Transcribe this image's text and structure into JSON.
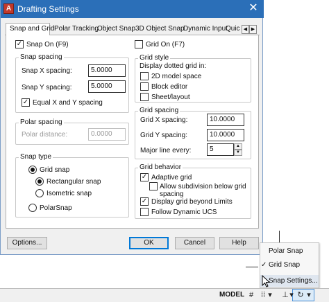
{
  "dialog": {
    "title": "Drafting Settings",
    "close_glyph": "✕",
    "tabs": [
      {
        "label": "Snap and Grid",
        "active": true
      },
      {
        "label": "Polar Tracking"
      },
      {
        "label": "Object Snap"
      },
      {
        "label": "3D Object Snap"
      },
      {
        "label": "Dynamic Input"
      },
      {
        "label": "Quic"
      }
    ],
    "tab_scroll_left": "◀",
    "tab_scroll_right": "▶",
    "snap_on": {
      "label": "Snap On (F9)",
      "checked": true
    },
    "grid_on": {
      "label": "Grid On (F7)",
      "checked": false
    },
    "snap_spacing": {
      "legend": "Snap spacing",
      "x_label": "Snap X spacing:",
      "x_value": "5.0000",
      "y_label": "Snap Y spacing:",
      "y_value": "5.0000",
      "equal_label": "Equal X and Y spacing",
      "equal_checked": true
    },
    "polar_spacing": {
      "legend": "Polar spacing",
      "distance_label": "Polar distance:",
      "distance_value": "0.0000"
    },
    "snap_type": {
      "legend": "Snap type",
      "grid_snap": "Grid snap",
      "rectangular": "Rectangular snap",
      "isometric": "Isometric snap",
      "polar_snap": "PolarSnap"
    },
    "grid_style": {
      "legend": "Grid style",
      "heading": "Display dotted grid in:",
      "options": [
        "2D model space",
        "Block editor",
        "Sheet/layout"
      ]
    },
    "grid_spacing": {
      "legend": "Grid spacing",
      "x_label": "Grid X spacing:",
      "x_value": "10.0000",
      "y_label": "Grid Y spacing:",
      "y_value": "10.0000",
      "major_label": "Major line every:",
      "major_value": "5"
    },
    "grid_behavior": {
      "legend": "Grid behavior",
      "adaptive": "Adaptive grid",
      "subdivision_line1": "Allow subdivision below grid",
      "subdivision_line2": "spacing",
      "beyond_limits": "Display grid beyond Limits",
      "follow_ucs": "Follow Dynamic UCS"
    },
    "buttons": {
      "options": "Options...",
      "ok": "OK",
      "cancel": "Cancel",
      "help": "Help"
    }
  },
  "menu": {
    "items": [
      "Polar Snap",
      "Grid Snap",
      "Snap Settings..."
    ],
    "checked_mark": "✓"
  },
  "status_bar": {
    "model": "MODEL",
    "icons": {
      "grid": "#",
      "dots": "⁞⁞",
      "caret": "▾",
      "snap_mode": "⊥",
      "snap_caret": "▾",
      "polar": "↻",
      "polar_caret": "▾"
    }
  },
  "colors": {
    "title_bar": "#2b6fb8",
    "dialog_bg": "#f0f0f0",
    "highlight": "#dfe6ef",
    "default_button_border": "#0078d7"
  }
}
